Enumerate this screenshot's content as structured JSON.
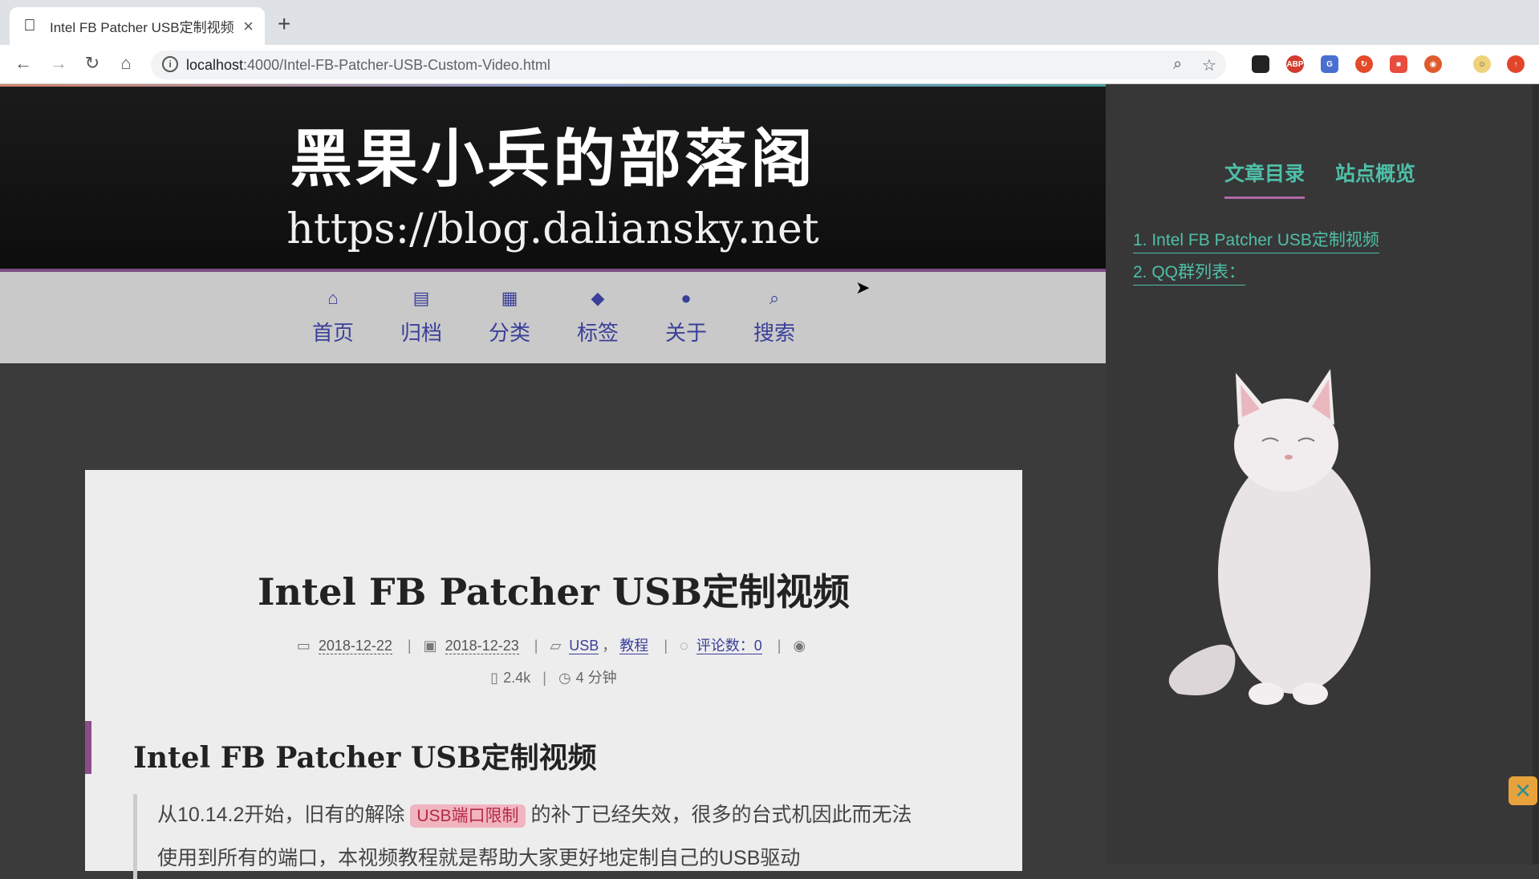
{
  "browser": {
    "tab_title": "Intel FB Patcher USB定制视频",
    "tab_close": "×",
    "new_tab": "+",
    "url_host": "localhost",
    "url_rest": ":4000/Intel-FB-Patcher-USB-Custom-Video.html",
    "extensions": [
      {
        "name": "ext-ghost",
        "color": "#222222",
        "text": ""
      },
      {
        "name": "ext-adblock",
        "color": "#d33b2c",
        "text": "ABP"
      },
      {
        "name": "ext-translate",
        "color": "#4a6fd1",
        "text": "G"
      },
      {
        "name": "ext-sync",
        "color": "#e24a2a",
        "text": ""
      },
      {
        "name": "ext-app",
        "color": "#e84c3d",
        "text": ""
      },
      {
        "name": "ext-weibo",
        "color": "#e05a2c",
        "text": ""
      }
    ]
  },
  "site": {
    "title": "黑果小兵的部落阁",
    "subtitle": "https://blog.daliansky.net",
    "menu": [
      {
        "icon": "home-icon",
        "glyph": "⌂",
        "label": "首页"
      },
      {
        "icon": "archive-icon",
        "glyph": "▤",
        "label": "归档"
      },
      {
        "icon": "grid-icon",
        "glyph": "▦",
        "label": "分类"
      },
      {
        "icon": "tags-icon",
        "glyph": "◆",
        "label": "标签"
      },
      {
        "icon": "user-icon",
        "glyph": "●",
        "label": "关于"
      },
      {
        "icon": "search-icon",
        "glyph": "⌕",
        "label": "搜索"
      }
    ]
  },
  "post": {
    "title": "Intel FB Patcher USB定制视频",
    "created": "2018-12-22",
    "updated": "2018-12-23",
    "categories": [
      "USB",
      "教程"
    ],
    "category_sep": "，",
    "comments_label": "评论数：",
    "comments_count": "0",
    "word_count": "2.4k",
    "read_time": "4 分钟",
    "h2": "Intel FB Patcher USB定制视频",
    "quote_pre": "从10.14.2开始，旧有的解除",
    "quote_tag": "USB端口限制",
    "quote_post": "的补丁已经失效，很多的台式机因此而无法",
    "quote_line2": "使用到所有的端口，本视频教程就是帮助大家更好地定制自己的USB驱动"
  },
  "sidebar": {
    "tabs": [
      "文章目录",
      "站点概览"
    ],
    "toc": [
      "1. Intel FB Patcher USB定制视频",
      "2. QQ群列表："
    ]
  },
  "colors": {
    "accent_teal": "#4fbfa8",
    "nav_blue": "#3a3f99",
    "tag_pink": "#f1b5bf"
  }
}
